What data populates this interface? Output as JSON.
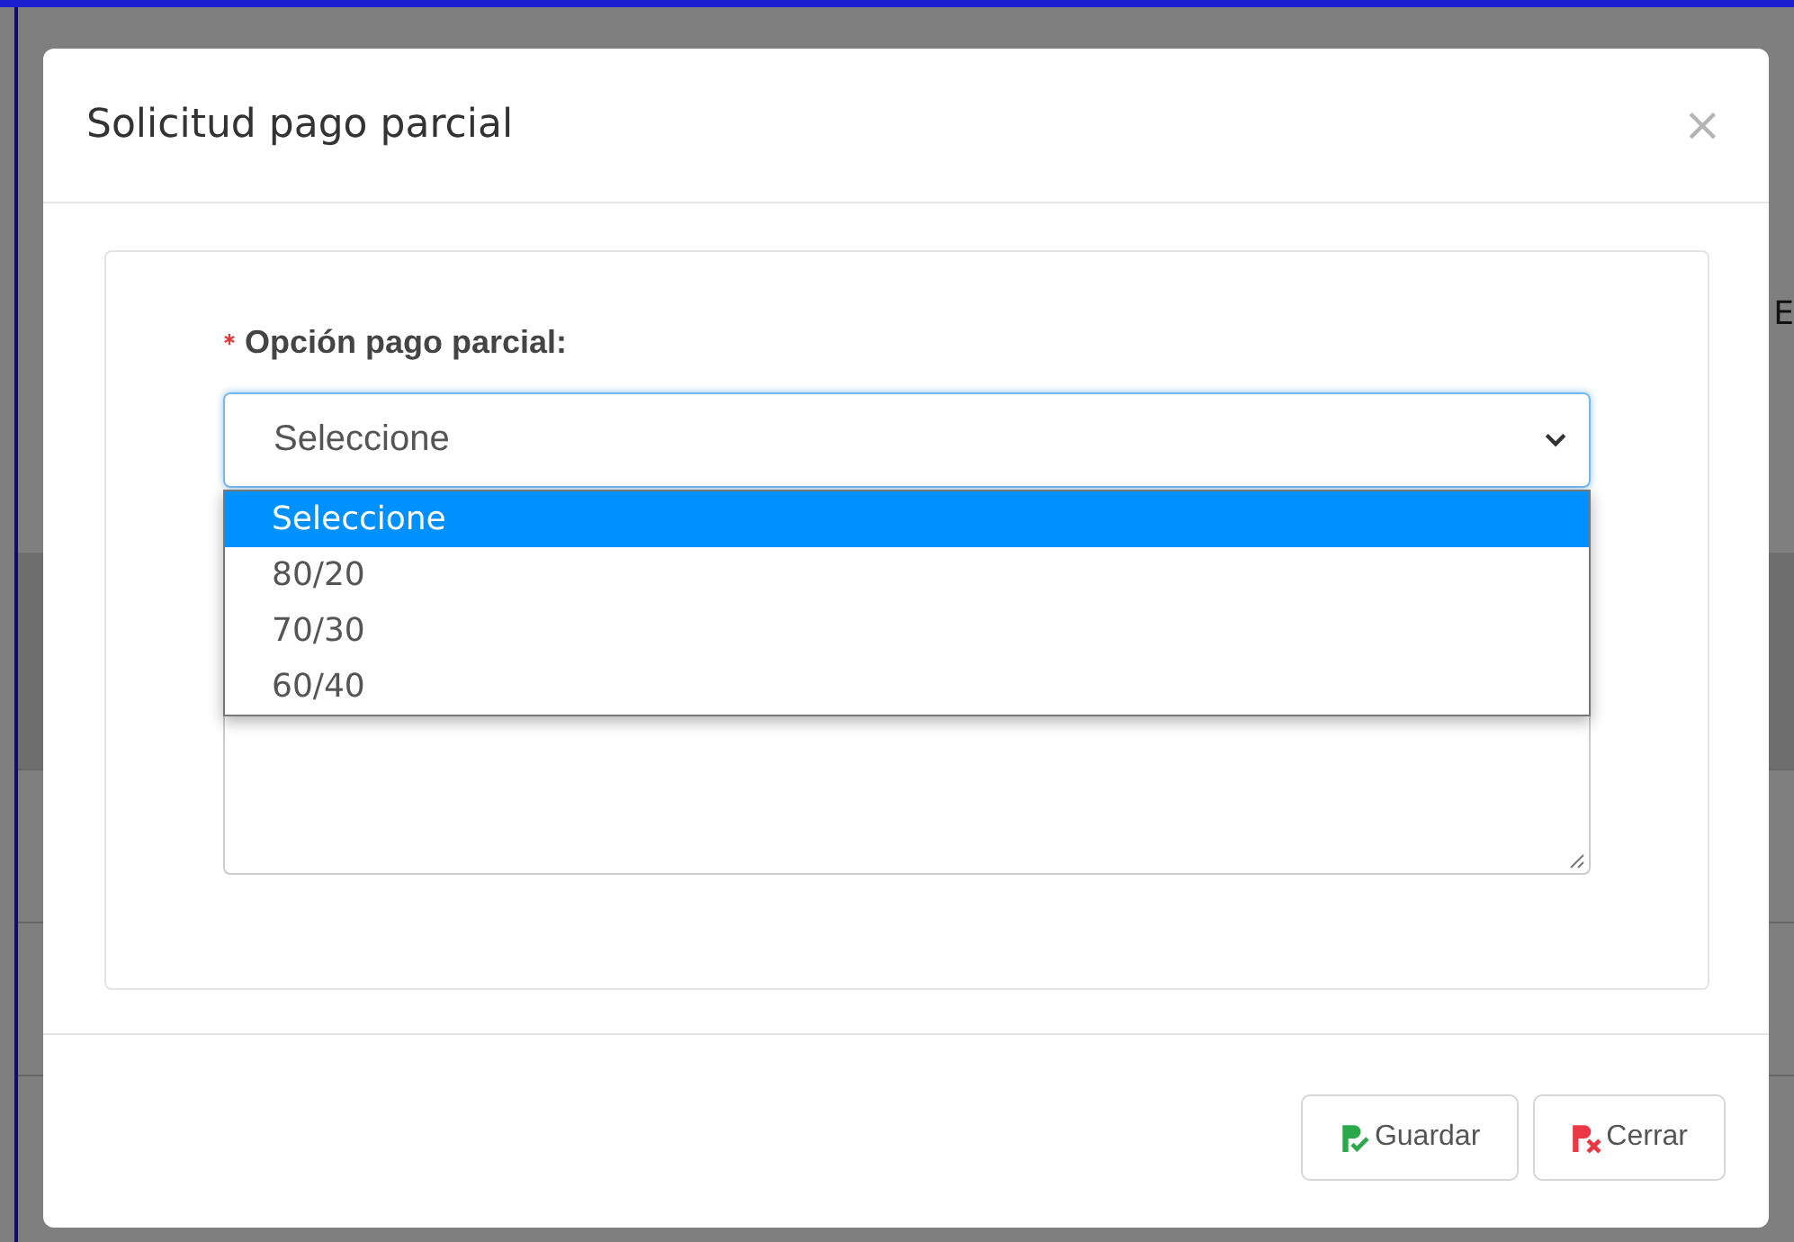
{
  "background": {
    "right_fragment": "E",
    "rows": [
      {
        "kind": "header"
      },
      {
        "kind": "row"
      },
      {
        "kind": "row"
      }
    ]
  },
  "modal": {
    "title": "Solicitud pago parcial",
    "close": "×",
    "field": {
      "label": "Opción pago parcial:",
      "required": true,
      "value": "Seleccione",
      "expanded": true,
      "options": [
        {
          "label": "Seleccione",
          "selected": true
        },
        {
          "label": "80/20",
          "selected": false
        },
        {
          "label": "70/30",
          "selected": false
        },
        {
          "label": "60/40",
          "selected": false
        }
      ]
    },
    "buttons": [
      {
        "label": "Guardar",
        "kind": "save"
      },
      {
        "label": "Cerrar",
        "kind": "close"
      }
    ]
  }
}
